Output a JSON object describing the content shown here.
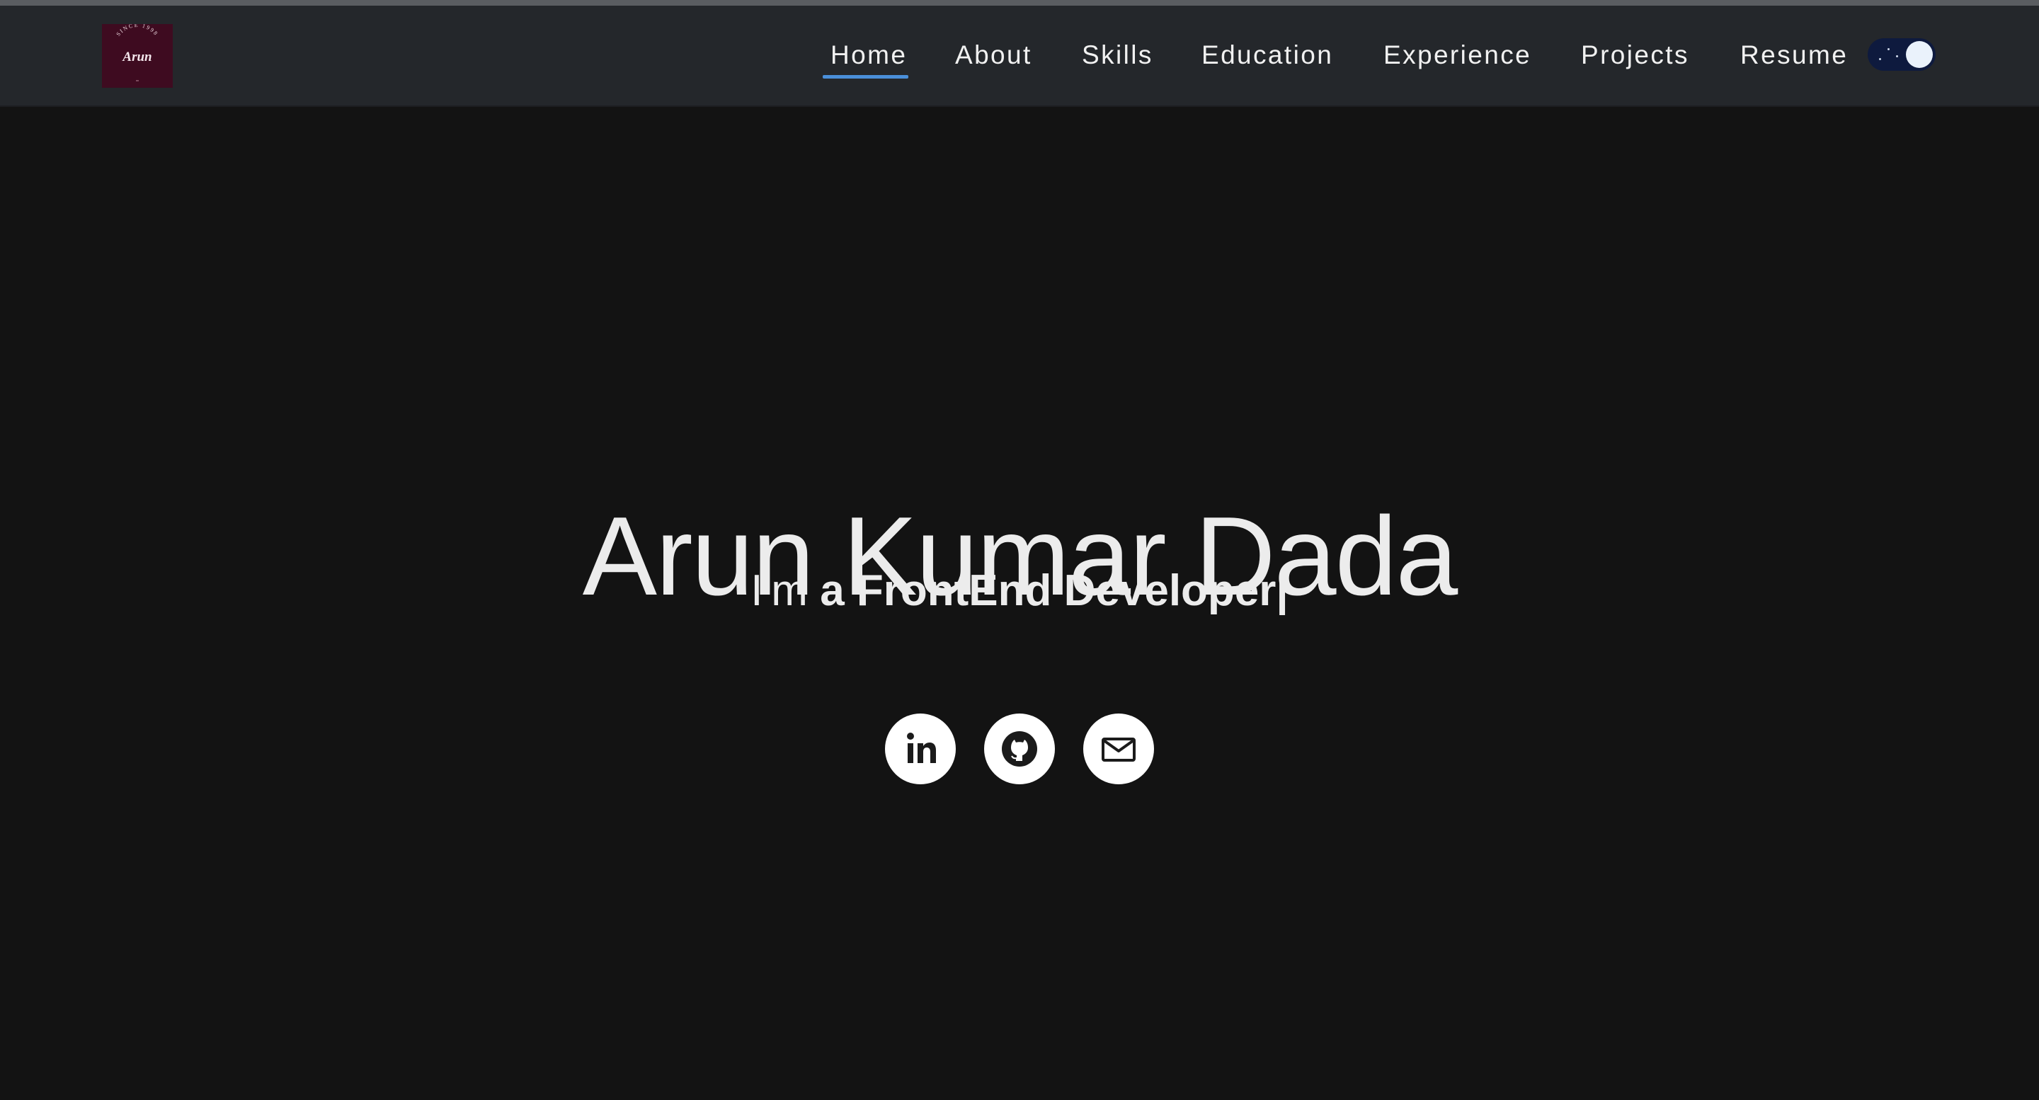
{
  "navbar": {
    "logo": {
      "top_text": "SINCE 1998",
      "name": "Arun"
    },
    "items": [
      {
        "label": "Home",
        "active": true
      },
      {
        "label": "About",
        "active": false
      },
      {
        "label": "Skills",
        "active": false
      },
      {
        "label": "Education",
        "active": false
      },
      {
        "label": "Experience",
        "active": false
      },
      {
        "label": "Projects",
        "active": false
      },
      {
        "label": "Resume",
        "active": false
      }
    ],
    "theme_toggle": {
      "mode": "dark"
    }
  },
  "hero": {
    "name": "Arun Kumar Dada",
    "greeting": "I'm",
    "role": "a FrontEnd Developer",
    "cursor": "|"
  },
  "social": [
    {
      "name": "linkedin",
      "icon": "linkedin-icon"
    },
    {
      "name": "github",
      "icon": "github-icon"
    },
    {
      "name": "email",
      "icon": "mail-icon"
    }
  ],
  "colors": {
    "background": "#131313",
    "navbar": "#24272b",
    "text": "#ececec",
    "accent": "#4a8fd9",
    "logo_bg": "#3e0b20",
    "toggle_bg": "#0e1a3e"
  }
}
